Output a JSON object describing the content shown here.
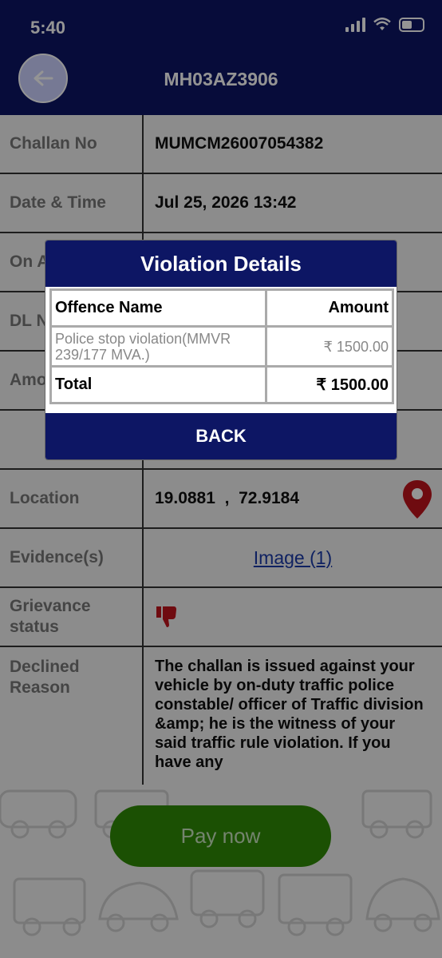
{
  "status_bar": {
    "time": "5:40",
    "battery": "6"
  },
  "header": {
    "title": "MH03AZ3906"
  },
  "details": {
    "challan_label": "Challan No",
    "challan_value": "MUMCM26007054382",
    "date_label": "Date & Time",
    "date_value": "Jul 25, 2026 13:42",
    "on_label": "On A",
    "dl_label": "DL N",
    "amount_label": "Amo",
    "location_label": "Location",
    "location_value": "19.0881  ,  72.9184",
    "evidence_label": "Evidence(s)",
    "evidence_value": "Image (1)",
    "grievance_label": "Grievance status",
    "declined_label": "Declined Reason",
    "declined_value": "The challan  is issued against your vehicle by on-duty traffic police constable/ officer of  Traffic division &amp; he is the witness of your said traffic rule violation. If you have any"
  },
  "pay_button": "Pay now",
  "modal": {
    "title": "Violation Details",
    "col_offence": "Offence Name",
    "col_amount": "Amount",
    "offence_name": "Police stop violation(MMVR 239/177 MVA.)",
    "offence_amount": "₹ 1500.00",
    "total_label": "Total",
    "total_amount": "₹ 1500.00",
    "back_label": "BACK"
  },
  "colors": {
    "navy": "#0d1664",
    "pay_green": "#2f8a06",
    "pin_red": "#c0141c"
  }
}
